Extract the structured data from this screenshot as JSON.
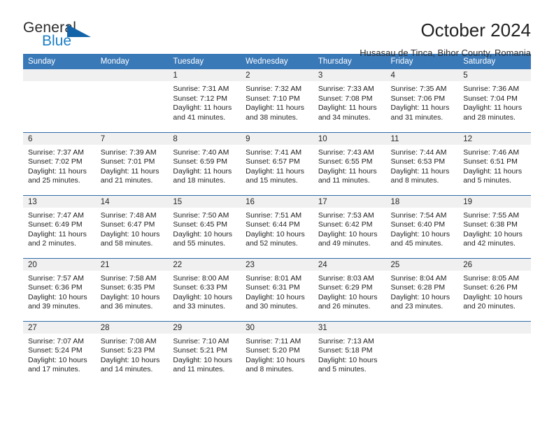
{
  "brand": {
    "name_part1": "General",
    "name_part2": "Blue"
  },
  "header": {
    "month_title": "October 2024",
    "location": "Husasau de Tinca, Bihor County, Romania"
  },
  "colors": {
    "header_blue": "#3a79b8",
    "row_divider_blue": "#2f6da8",
    "daynum_band": "#f0f0f0",
    "logo_blue": "#1b7fc4",
    "logo_triangle": "#1263a8"
  },
  "weekdays": [
    "Sunday",
    "Monday",
    "Tuesday",
    "Wednesday",
    "Thursday",
    "Friday",
    "Saturday"
  ],
  "weeks": [
    [
      {
        "day": "",
        "sunrise": "",
        "sunset": "",
        "daylight_line1": "",
        "daylight_line2": ""
      },
      {
        "day": "",
        "sunrise": "",
        "sunset": "",
        "daylight_line1": "",
        "daylight_line2": ""
      },
      {
        "day": "1",
        "sunrise": "Sunrise: 7:31 AM",
        "sunset": "Sunset: 7:12 PM",
        "daylight_line1": "Daylight: 11 hours",
        "daylight_line2": "and 41 minutes."
      },
      {
        "day": "2",
        "sunrise": "Sunrise: 7:32 AM",
        "sunset": "Sunset: 7:10 PM",
        "daylight_line1": "Daylight: 11 hours",
        "daylight_line2": "and 38 minutes."
      },
      {
        "day": "3",
        "sunrise": "Sunrise: 7:33 AM",
        "sunset": "Sunset: 7:08 PM",
        "daylight_line1": "Daylight: 11 hours",
        "daylight_line2": "and 34 minutes."
      },
      {
        "day": "4",
        "sunrise": "Sunrise: 7:35 AM",
        "sunset": "Sunset: 7:06 PM",
        "daylight_line1": "Daylight: 11 hours",
        "daylight_line2": "and 31 minutes."
      },
      {
        "day": "5",
        "sunrise": "Sunrise: 7:36 AM",
        "sunset": "Sunset: 7:04 PM",
        "daylight_line1": "Daylight: 11 hours",
        "daylight_line2": "and 28 minutes."
      }
    ],
    [
      {
        "day": "6",
        "sunrise": "Sunrise: 7:37 AM",
        "sunset": "Sunset: 7:02 PM",
        "daylight_line1": "Daylight: 11 hours",
        "daylight_line2": "and 25 minutes."
      },
      {
        "day": "7",
        "sunrise": "Sunrise: 7:39 AM",
        "sunset": "Sunset: 7:01 PM",
        "daylight_line1": "Daylight: 11 hours",
        "daylight_line2": "and 21 minutes."
      },
      {
        "day": "8",
        "sunrise": "Sunrise: 7:40 AM",
        "sunset": "Sunset: 6:59 PM",
        "daylight_line1": "Daylight: 11 hours",
        "daylight_line2": "and 18 minutes."
      },
      {
        "day": "9",
        "sunrise": "Sunrise: 7:41 AM",
        "sunset": "Sunset: 6:57 PM",
        "daylight_line1": "Daylight: 11 hours",
        "daylight_line2": "and 15 minutes."
      },
      {
        "day": "10",
        "sunrise": "Sunrise: 7:43 AM",
        "sunset": "Sunset: 6:55 PM",
        "daylight_line1": "Daylight: 11 hours",
        "daylight_line2": "and 11 minutes."
      },
      {
        "day": "11",
        "sunrise": "Sunrise: 7:44 AM",
        "sunset": "Sunset: 6:53 PM",
        "daylight_line1": "Daylight: 11 hours",
        "daylight_line2": "and 8 minutes."
      },
      {
        "day": "12",
        "sunrise": "Sunrise: 7:46 AM",
        "sunset": "Sunset: 6:51 PM",
        "daylight_line1": "Daylight: 11 hours",
        "daylight_line2": "and 5 minutes."
      }
    ],
    [
      {
        "day": "13",
        "sunrise": "Sunrise: 7:47 AM",
        "sunset": "Sunset: 6:49 PM",
        "daylight_line1": "Daylight: 11 hours",
        "daylight_line2": "and 2 minutes."
      },
      {
        "day": "14",
        "sunrise": "Sunrise: 7:48 AM",
        "sunset": "Sunset: 6:47 PM",
        "daylight_line1": "Daylight: 10 hours",
        "daylight_line2": "and 58 minutes."
      },
      {
        "day": "15",
        "sunrise": "Sunrise: 7:50 AM",
        "sunset": "Sunset: 6:45 PM",
        "daylight_line1": "Daylight: 10 hours",
        "daylight_line2": "and 55 minutes."
      },
      {
        "day": "16",
        "sunrise": "Sunrise: 7:51 AM",
        "sunset": "Sunset: 6:44 PM",
        "daylight_line1": "Daylight: 10 hours",
        "daylight_line2": "and 52 minutes."
      },
      {
        "day": "17",
        "sunrise": "Sunrise: 7:53 AM",
        "sunset": "Sunset: 6:42 PM",
        "daylight_line1": "Daylight: 10 hours",
        "daylight_line2": "and 49 minutes."
      },
      {
        "day": "18",
        "sunrise": "Sunrise: 7:54 AM",
        "sunset": "Sunset: 6:40 PM",
        "daylight_line1": "Daylight: 10 hours",
        "daylight_line2": "and 45 minutes."
      },
      {
        "day": "19",
        "sunrise": "Sunrise: 7:55 AM",
        "sunset": "Sunset: 6:38 PM",
        "daylight_line1": "Daylight: 10 hours",
        "daylight_line2": "and 42 minutes."
      }
    ],
    [
      {
        "day": "20",
        "sunrise": "Sunrise: 7:57 AM",
        "sunset": "Sunset: 6:36 PM",
        "daylight_line1": "Daylight: 10 hours",
        "daylight_line2": "and 39 minutes."
      },
      {
        "day": "21",
        "sunrise": "Sunrise: 7:58 AM",
        "sunset": "Sunset: 6:35 PM",
        "daylight_line1": "Daylight: 10 hours",
        "daylight_line2": "and 36 minutes."
      },
      {
        "day": "22",
        "sunrise": "Sunrise: 8:00 AM",
        "sunset": "Sunset: 6:33 PM",
        "daylight_line1": "Daylight: 10 hours",
        "daylight_line2": "and 33 minutes."
      },
      {
        "day": "23",
        "sunrise": "Sunrise: 8:01 AM",
        "sunset": "Sunset: 6:31 PM",
        "daylight_line1": "Daylight: 10 hours",
        "daylight_line2": "and 30 minutes."
      },
      {
        "day": "24",
        "sunrise": "Sunrise: 8:03 AM",
        "sunset": "Sunset: 6:29 PM",
        "daylight_line1": "Daylight: 10 hours",
        "daylight_line2": "and 26 minutes."
      },
      {
        "day": "25",
        "sunrise": "Sunrise: 8:04 AM",
        "sunset": "Sunset: 6:28 PM",
        "daylight_line1": "Daylight: 10 hours",
        "daylight_line2": "and 23 minutes."
      },
      {
        "day": "26",
        "sunrise": "Sunrise: 8:05 AM",
        "sunset": "Sunset: 6:26 PM",
        "daylight_line1": "Daylight: 10 hours",
        "daylight_line2": "and 20 minutes."
      }
    ],
    [
      {
        "day": "27",
        "sunrise": "Sunrise: 7:07 AM",
        "sunset": "Sunset: 5:24 PM",
        "daylight_line1": "Daylight: 10 hours",
        "daylight_line2": "and 17 minutes."
      },
      {
        "day": "28",
        "sunrise": "Sunrise: 7:08 AM",
        "sunset": "Sunset: 5:23 PM",
        "daylight_line1": "Daylight: 10 hours",
        "daylight_line2": "and 14 minutes."
      },
      {
        "day": "29",
        "sunrise": "Sunrise: 7:10 AM",
        "sunset": "Sunset: 5:21 PM",
        "daylight_line1": "Daylight: 10 hours",
        "daylight_line2": "and 11 minutes."
      },
      {
        "day": "30",
        "sunrise": "Sunrise: 7:11 AM",
        "sunset": "Sunset: 5:20 PM",
        "daylight_line1": "Daylight: 10 hours",
        "daylight_line2": "and 8 minutes."
      },
      {
        "day": "31",
        "sunrise": "Sunrise: 7:13 AM",
        "sunset": "Sunset: 5:18 PM",
        "daylight_line1": "Daylight: 10 hours",
        "daylight_line2": "and 5 minutes."
      },
      {
        "day": "",
        "sunrise": "",
        "sunset": "",
        "daylight_line1": "",
        "daylight_line2": ""
      },
      {
        "day": "",
        "sunrise": "",
        "sunset": "",
        "daylight_line1": "",
        "daylight_line2": ""
      }
    ]
  ]
}
